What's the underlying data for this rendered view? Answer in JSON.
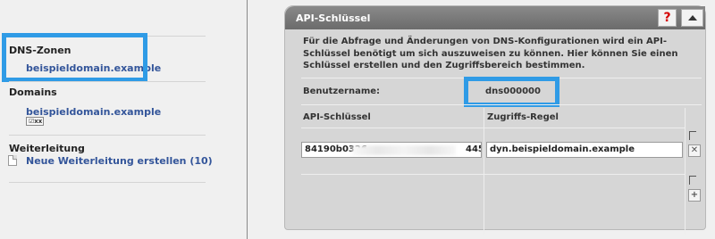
{
  "sidebar": {
    "dns_zones": {
      "title": "DNS-Zonen",
      "domain": "beispieldomain.example"
    },
    "domains": {
      "title": "Domains",
      "domain": "beispieldomain.example",
      "badge": "xx"
    },
    "forwarding": {
      "title": "Weiterleitung",
      "new_link": "Neue Weiterleitung erstellen (10)"
    }
  },
  "panel": {
    "title": "API-Schlüssel",
    "help_label": "?",
    "description": "Für die Abfrage und Änderungen von DNS-Konfigurationen wird ein API-Schlüssel benötigt um sich auszuweisen zu können. Hier können Sie einen Schlüssel erstellen und den Zugriffsbereich bestimmen.",
    "username_label": "Benutzername:",
    "username_value": "dns000000",
    "col_key": "API-Schlüssel",
    "col_rule": "Zugriffs-Regel",
    "key_prefix": "84190b0326",
    "key_suffix": "445",
    "rule_value": "dyn.beispieldomain.example",
    "remove_label": "✕",
    "add_label": "+"
  },
  "colors": {
    "highlight": "#2f9be6",
    "link": "#33559a",
    "help": "#d40000"
  }
}
